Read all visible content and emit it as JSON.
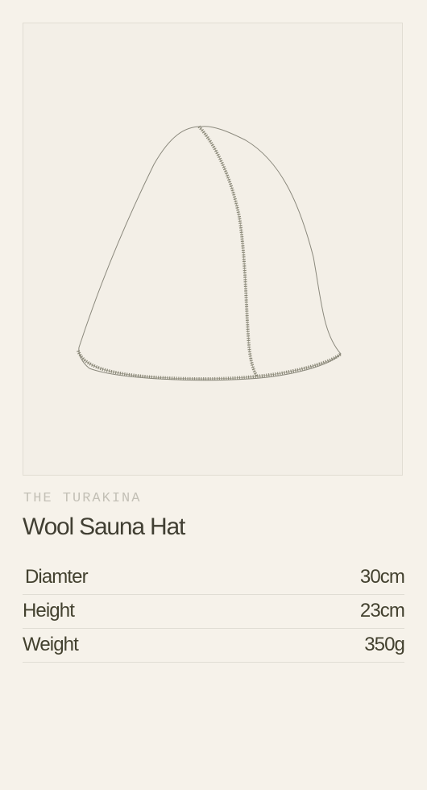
{
  "product": {
    "eyebrow": "THE TURAKINA",
    "title": "Wool Sauna Hat",
    "image_icon": "sauna-hat-line-drawing"
  },
  "specs": [
    {
      "label": "Diamter",
      "value": "30cm"
    },
    {
      "label": "Height",
      "value": "23cm"
    },
    {
      "label": "Weight",
      "value": "350g"
    }
  ],
  "colors": {
    "background": "#f6f2ea",
    "image_background": "#f3efe7",
    "text": "#413f33",
    "eyebrow": "#c3c0b6",
    "divider": "#e0ddd4",
    "stitch": "#8a8878"
  }
}
